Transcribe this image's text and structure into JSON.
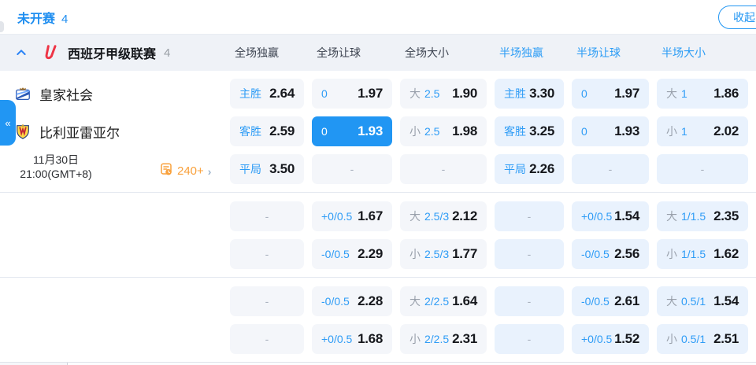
{
  "colors": {
    "accent_blue": "#2196f3",
    "label_blue": "#2e9cf6",
    "half_col_bg": "#e9f2fd",
    "full_col_bg": "#f4f6fa",
    "markets_orange": "#f9a13c"
  },
  "topbar": {
    "status_tab": "未开赛",
    "count": "4",
    "collapse_button": "收起"
  },
  "league": {
    "name": "西班牙甲级联赛",
    "count": "4",
    "columns": [
      {
        "label": "全场独赢",
        "scope": "full"
      },
      {
        "label": "全场让球",
        "scope": "full"
      },
      {
        "label": "全场大小",
        "scope": "full"
      },
      {
        "label": "半场独赢",
        "scope": "half"
      },
      {
        "label": "半场让球",
        "scope": "half"
      },
      {
        "label": "半场大小",
        "scope": "half"
      }
    ]
  },
  "match": {
    "home_team": "皇家社会",
    "away_team": "比利亚雷亚尔",
    "date": "11月30日",
    "time": "21:00(GMT+8)",
    "more_markets": "240+",
    "more_markets_arrow": "›",
    "sidebar_toggle": "«",
    "empty_placeholder": "-"
  },
  "odds_groups": [
    {
      "rows": [
        [
          {
            "pick": "主胜",
            "odds": "2.64"
          },
          {
            "line": "0",
            "odds": "1.97"
          },
          {
            "pick": "大",
            "line": "2.5",
            "odds": "1.90"
          },
          {
            "pick": "主胜",
            "odds": "3.30"
          },
          {
            "line": "0",
            "odds": "1.97"
          },
          {
            "pick": "大",
            "line": "1",
            "odds": "1.86"
          }
        ],
        [
          {
            "pick": "客胜",
            "odds": "2.59"
          },
          {
            "line": "0",
            "odds": "1.93",
            "selected": true
          },
          {
            "pick": "小",
            "line": "2.5",
            "odds": "1.98"
          },
          {
            "pick": "客胜",
            "odds": "3.25"
          },
          {
            "line": "0",
            "odds": "1.93"
          },
          {
            "pick": "小",
            "line": "1",
            "odds": "2.02"
          }
        ],
        [
          {
            "pick": "平局",
            "odds": "3.50"
          },
          {
            "empty": true
          },
          {
            "empty": true
          },
          {
            "pick": "平局",
            "odds": "2.26"
          },
          {
            "empty": true
          },
          {
            "empty": true
          }
        ]
      ]
    },
    {
      "rows": [
        [
          {
            "empty": true
          },
          {
            "line": "+0/0.5",
            "odds": "1.67"
          },
          {
            "pick": "大",
            "line": "2.5/3",
            "odds": "2.12"
          },
          {
            "empty": true
          },
          {
            "line": "+0/0.5",
            "odds": "1.54"
          },
          {
            "pick": "大",
            "line": "1/1.5",
            "odds": "2.35"
          }
        ],
        [
          {
            "empty": true
          },
          {
            "line": "-0/0.5",
            "odds": "2.29"
          },
          {
            "pick": "小",
            "line": "2.5/3",
            "odds": "1.77"
          },
          {
            "empty": true
          },
          {
            "line": "-0/0.5",
            "odds": "2.56"
          },
          {
            "pick": "小",
            "line": "1/1.5",
            "odds": "1.62"
          }
        ]
      ]
    },
    {
      "rows": [
        [
          {
            "empty": true
          },
          {
            "line": "-0/0.5",
            "odds": "2.28"
          },
          {
            "pick": "大",
            "line": "2/2.5",
            "odds": "1.64"
          },
          {
            "empty": true
          },
          {
            "line": "-0/0.5",
            "odds": "2.61"
          },
          {
            "pick": "大",
            "line": "0.5/1",
            "odds": "1.54"
          }
        ],
        [
          {
            "empty": true
          },
          {
            "line": "+0/0.5",
            "odds": "1.68"
          },
          {
            "pick": "小",
            "line": "2/2.5",
            "odds": "2.31"
          },
          {
            "empty": true
          },
          {
            "line": "+0/0.5",
            "odds": "1.52"
          },
          {
            "pick": "小",
            "line": "0.5/1",
            "odds": "2.51"
          }
        ]
      ]
    }
  ]
}
